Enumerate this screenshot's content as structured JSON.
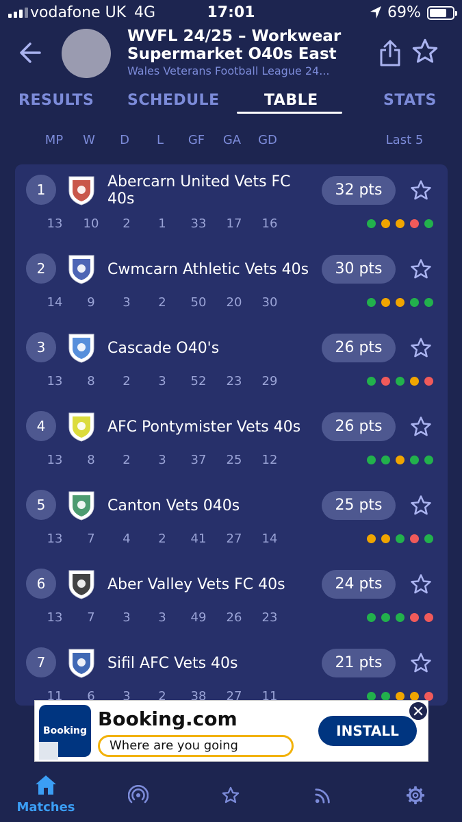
{
  "status_bar": {
    "carrier": "vodafone UK",
    "network": "4G",
    "time": "17:01",
    "battery": "69%"
  },
  "header": {
    "title_line1": "WVFL 24/25 – Workwear",
    "title_line2": "Supermarket O40s East",
    "subtitle": "Wales Veterans Football League 24..."
  },
  "tabs": [
    {
      "label": "RESULTS",
      "active": false
    },
    {
      "label": "SCHEDULE",
      "active": false
    },
    {
      "label": "TABLE",
      "active": true
    },
    {
      "label": "STATS",
      "active": false
    }
  ],
  "columns": [
    "MP",
    "W",
    "D",
    "L",
    "GF",
    "GA",
    "GD"
  ],
  "last5_label": "Last 5",
  "colors": {
    "win": "#22b14c",
    "draw": "#f0a500",
    "loss": "#f05a5a",
    "accent": "#3b9ef5",
    "background": "#1d2550",
    "card": "#27306a",
    "pill": "#4e5890"
  },
  "table": [
    {
      "pos": "1",
      "name": "Abercarn United Vets FC 40s",
      "pts": "32 pts",
      "stats": [
        "13",
        "10",
        "2",
        "1",
        "33",
        "17",
        "16"
      ],
      "form": [
        "W",
        "D",
        "D",
        "L",
        "W"
      ],
      "logo": "crest-abercarn"
    },
    {
      "pos": "2",
      "name": "Cwmcarn Athletic Vets 40s",
      "pts": "30 pts",
      "stats": [
        "14",
        "9",
        "3",
        "2",
        "50",
        "20",
        "30"
      ],
      "form": [
        "W",
        "D",
        "D",
        "W",
        "W"
      ],
      "logo": "crest-cwmcarn"
    },
    {
      "pos": "3",
      "name": "Cascade O40's",
      "pts": "26 pts",
      "stats": [
        "13",
        "8",
        "2",
        "3",
        "52",
        "23",
        "29"
      ],
      "form": [
        "W",
        "L",
        "W",
        "D",
        "L"
      ],
      "logo": "crest-cascade"
    },
    {
      "pos": "4",
      "name": "AFC Pontymister Vets 40s",
      "pts": "26 pts",
      "stats": [
        "13",
        "8",
        "2",
        "3",
        "37",
        "25",
        "12"
      ],
      "form": [
        "W",
        "W",
        "D",
        "W",
        "W"
      ],
      "logo": "crest-pontymister"
    },
    {
      "pos": "5",
      "name": "Canton Vets 040s",
      "pts": "25 pts",
      "stats": [
        "13",
        "7",
        "4",
        "2",
        "41",
        "27",
        "14"
      ],
      "form": [
        "D",
        "D",
        "W",
        "L",
        "W"
      ],
      "logo": "crest-canton"
    },
    {
      "pos": "6",
      "name": "Aber Valley Vets FC 40s",
      "pts": "24 pts",
      "stats": [
        "13",
        "7",
        "3",
        "3",
        "49",
        "26",
        "23"
      ],
      "form": [
        "W",
        "W",
        "W",
        "L",
        "L"
      ],
      "logo": "crest-aber-valley"
    },
    {
      "pos": "7",
      "name": "Sifil AFC Vets 40s",
      "pts": "21 pts",
      "stats": [
        "11",
        "6",
        "3",
        "2",
        "38",
        "27",
        "11"
      ],
      "form": [
        "W",
        "W",
        "D",
        "D",
        "L"
      ],
      "logo": "crest-sifil"
    }
  ],
  "ad": {
    "logo_text": "Booking",
    "title": "Booking.com",
    "search_placeholder": "Where are you going",
    "install_label": "INSTALL"
  },
  "bottom_nav": [
    {
      "label": "Matches",
      "icon": "home-icon",
      "active": true
    },
    {
      "label": "",
      "icon": "radio-icon",
      "active": false
    },
    {
      "label": "",
      "icon": "star-icon",
      "active": false
    },
    {
      "label": "",
      "icon": "rss-icon",
      "active": false
    },
    {
      "label": "",
      "icon": "gear-icon",
      "active": false
    }
  ]
}
